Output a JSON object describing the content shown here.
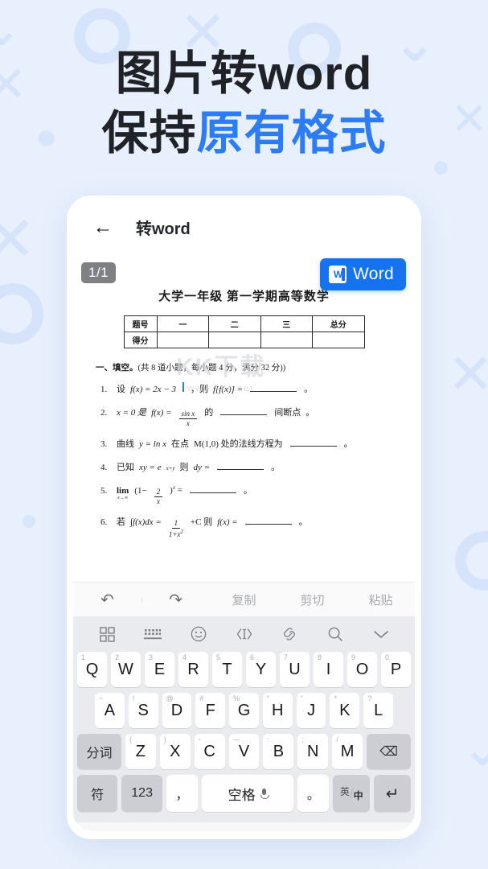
{
  "headline": {
    "line1": "图片转word",
    "line2_black": "保持",
    "line2_blue": "原有格式",
    "accent_color": "#2b7cf6"
  },
  "app": {
    "back_icon": "←",
    "title": "转word"
  },
  "document": {
    "page_badge": "1/1",
    "word_button": {
      "label": "Word",
      "icon": "word-icon",
      "bg_color": "#1573ef"
    },
    "title": "大学一年级 第一学期高等数学",
    "score_table": {
      "row_labels": [
        "题号",
        "得分"
      ],
      "columns": [
        "一",
        "二",
        "三",
        "总分"
      ]
    },
    "section_heading_bold": "一、填空。",
    "section_heading_rest": "(共 8 道小题，每小题 4 分，满分 32 分))",
    "questions": [
      {
        "num": "1.",
        "prefix": "设",
        "body": "f(x) = 2x − 3",
        "mid": "，则",
        "tail": "f[f(x)] =",
        "end": "。"
      },
      {
        "num": "2.",
        "prefix": "x = 0 是",
        "body": "f(x) =",
        "mid": "的",
        "tail": "间断点",
        "end": "。"
      },
      {
        "num": "3.",
        "prefix": "曲线",
        "body": "y = ln x",
        "mid": "在点",
        "tail": "M(1,0) 处的法线方程为",
        "end": "。"
      },
      {
        "num": "4.",
        "prefix": "已知",
        "body": "xy = e",
        "mid": "则",
        "tail": "dy =",
        "end": "。"
      },
      {
        "num": "5.",
        "prefix": "",
        "body": "lim",
        "mid": "",
        "tail": "=",
        "end": "。"
      },
      {
        "num": "6.",
        "prefix": "若",
        "body": "∫f(x)dx =",
        "mid": "+C  则",
        "tail": "f(x) =",
        "end": "。"
      }
    ],
    "watermark_main": "KK下载",
    "watermark_sub": "www.kkx.net"
  },
  "edit_toolbar": {
    "items": [
      {
        "name": "undo",
        "label": "↶",
        "type": "icon"
      },
      {
        "name": "redo",
        "label": "↷",
        "type": "icon"
      },
      {
        "name": "copy",
        "label": "复制",
        "type": "text"
      },
      {
        "name": "cut",
        "label": "剪切",
        "type": "text"
      },
      {
        "name": "paste",
        "label": "粘贴",
        "type": "text"
      }
    ]
  },
  "keyboard": {
    "tool_icons": [
      "grid-icon",
      "keyboard-icon",
      "emoji-icon",
      "text-cursor-icon",
      "clipboard-icon",
      "search-icon",
      "chevron-down-icon"
    ],
    "row1": [
      {
        "k": "Q",
        "alt": "1"
      },
      {
        "k": "W",
        "alt": "2"
      },
      {
        "k": "E",
        "alt": "3"
      },
      {
        "k": "R",
        "alt": "4"
      },
      {
        "k": "T",
        "alt": "5"
      },
      {
        "k": "Y",
        "alt": "6"
      },
      {
        "k": "U",
        "alt": "7"
      },
      {
        "k": "I",
        "alt": "8"
      },
      {
        "k": "O",
        "alt": "9"
      },
      {
        "k": "P",
        "alt": "0"
      }
    ],
    "row2": [
      {
        "k": "A",
        "alt": "~"
      },
      {
        "k": "S",
        "alt": "!"
      },
      {
        "k": "D",
        "alt": "@"
      },
      {
        "k": "F",
        "alt": "#"
      },
      {
        "k": "G",
        "alt": "%"
      },
      {
        "k": "H",
        "alt": "“"
      },
      {
        "k": "J",
        "alt": "”"
      },
      {
        "k": "K",
        "alt": "*"
      },
      {
        "k": "L",
        "alt": "?"
      }
    ],
    "row3_left": "分词",
    "row3": [
      {
        "k": "Z",
        "alt": "("
      },
      {
        "k": "X",
        "alt": ")"
      },
      {
        "k": "C",
        "alt": "-"
      },
      {
        "k": "V",
        "alt": "—"
      },
      {
        "k": "B",
        "alt": ":"
      },
      {
        "k": "N",
        "alt": ";"
      },
      {
        "k": "M",
        "alt": "/"
      }
    ],
    "row3_backspace": "⌫",
    "row4": {
      "symbol": "符",
      "numbers": "123",
      "comma": "，",
      "space": "空格",
      "period": "。",
      "lang_en": "英",
      "lang_cn": "中",
      "enter": "↵"
    }
  }
}
